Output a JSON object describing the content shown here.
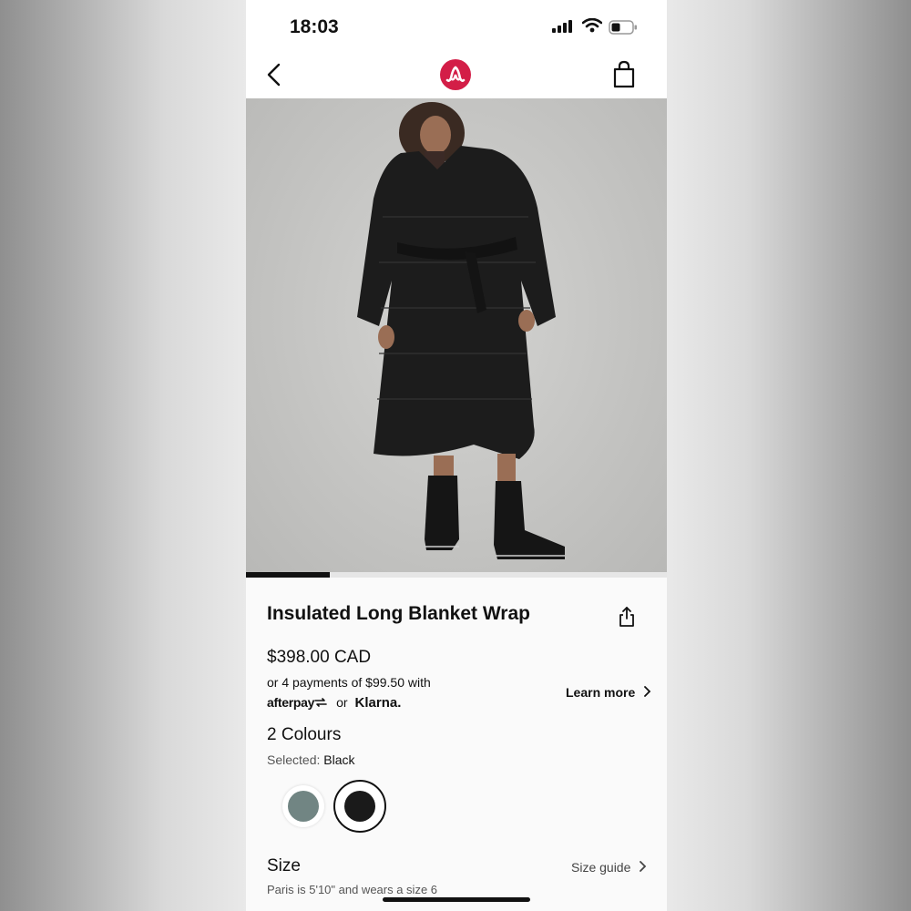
{
  "status_bar": {
    "time": "18:03"
  },
  "product": {
    "title": "Insulated Long Blanket Wrap",
    "price": "$398.00 CAD",
    "installments": "or 4 payments of $99.50 with",
    "afterpay_label": "afterpay",
    "or_label": "or",
    "klarna_label": "Klarna.",
    "learn_more": "Learn more",
    "colours_heading": "2 Colours",
    "selected_label": "Selected:",
    "selected_value": "Black",
    "swatches": [
      {
        "name": "Green",
        "color": "#718583",
        "selected": false
      },
      {
        "name": "Black",
        "color": "#1a1a1a",
        "selected": true
      }
    ],
    "size_heading": "Size",
    "size_guide": "Size guide",
    "model_info": "Paris is 5'10\" and wears a size 6"
  },
  "gallery": {
    "progress": 0.2
  },
  "colors": {
    "brand_red": "#d31e47",
    "text": "#111111"
  }
}
